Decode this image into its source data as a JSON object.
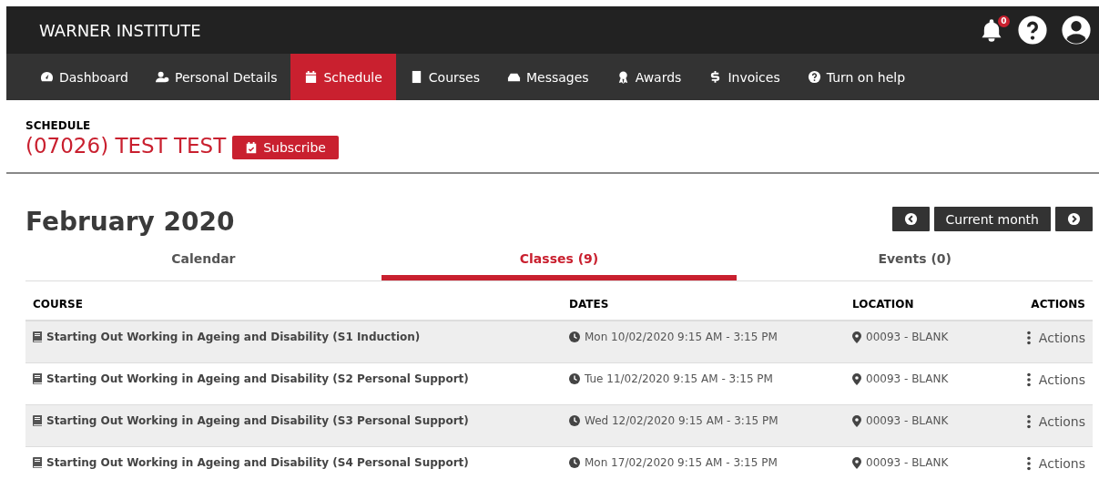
{
  "brand": "WARNER INSTITUTE",
  "notifications": {
    "count": "0"
  },
  "nav": [
    {
      "label": "Dashboard",
      "kind": "dashboard",
      "selected": false
    },
    {
      "label": "Personal Details",
      "kind": "user",
      "selected": false
    },
    {
      "label": "Schedule",
      "kind": "calendar",
      "selected": true
    },
    {
      "label": "Courses",
      "kind": "book",
      "selected": false
    },
    {
      "label": "Messages",
      "kind": "inbox",
      "selected": false
    },
    {
      "label": "Awards",
      "kind": "award",
      "selected": false
    },
    {
      "label": "Invoices",
      "kind": "dollar",
      "selected": false
    },
    {
      "label": "Turn on help",
      "kind": "help",
      "selected": false
    }
  ],
  "page": {
    "section": "SCHEDULE",
    "title": "(07026) TEST TEST",
    "subscribe": "Subscribe"
  },
  "month": {
    "title": "February 2020",
    "current": "Current month"
  },
  "tabs": [
    {
      "label": "Calendar",
      "selected": false
    },
    {
      "label": "Classes (9)",
      "selected": true
    },
    {
      "label": "Events (0)",
      "selected": false
    }
  ],
  "table": {
    "columns": [
      "COURSE",
      "DATES",
      "LOCATION",
      "ACTIONS"
    ],
    "rows": [
      {
        "course": "Starting Out Working in Ageing and Disability (S1 Induction)",
        "dates": "Mon 10/02/2020 9:15 AM - 3:15 PM",
        "location": "00093 - BLANK",
        "action": "Actions"
      },
      {
        "course": "Starting Out Working in Ageing and Disability (S2 Personal Support)",
        "dates": "Tue 11/02/2020 9:15 AM - 3:15 PM",
        "location": "00093 - BLANK",
        "action": "Actions"
      },
      {
        "course": "Starting Out Working in Ageing and Disability (S3 Personal Support)",
        "dates": "Wed 12/02/2020 9:15 AM - 3:15 PM",
        "location": "00093 - BLANK",
        "action": "Actions"
      },
      {
        "course": "Starting Out Working in Ageing and Disability (S4 Personal Support)",
        "dates": "Mon 17/02/2020 9:15 AM - 3:15 PM",
        "location": "00093 - BLANK",
        "action": "Actions"
      }
    ]
  }
}
